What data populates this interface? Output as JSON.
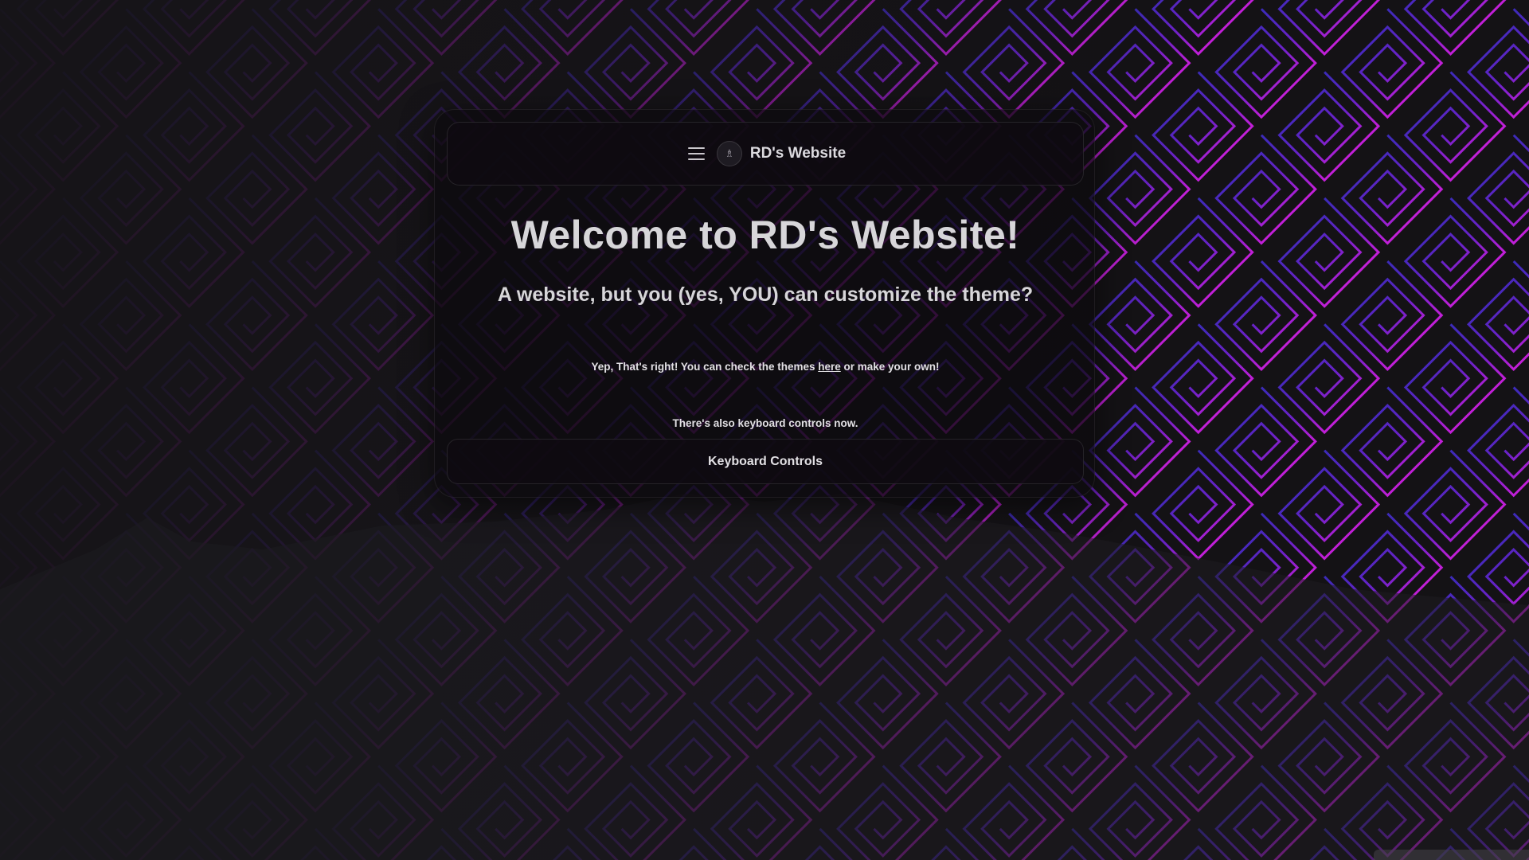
{
  "navbar": {
    "menu_icon": "hamburger-menu-icon",
    "logo_icon": "site-logo-icon",
    "logo_glyph": "♗",
    "site_name": "RD's Website"
  },
  "main": {
    "title": "Welcome to RD's Website!",
    "subtitle": "A website, but you (yes, YOU) can customize the theme?",
    "themes_text_before": "Yep, That's right! You can check the themes ",
    "themes_link": "here",
    "themes_text_after": " or make your own!",
    "keyboard_note": "There's also keyboard controls now.",
    "keyboard_button": "Keyboard Controls"
  },
  "colors": {
    "pattern_accent": "#b81fd6",
    "pattern_blue": "#3b2bb8",
    "text": "#d7d6d9",
    "card_bg": "#0c0a0e"
  }
}
